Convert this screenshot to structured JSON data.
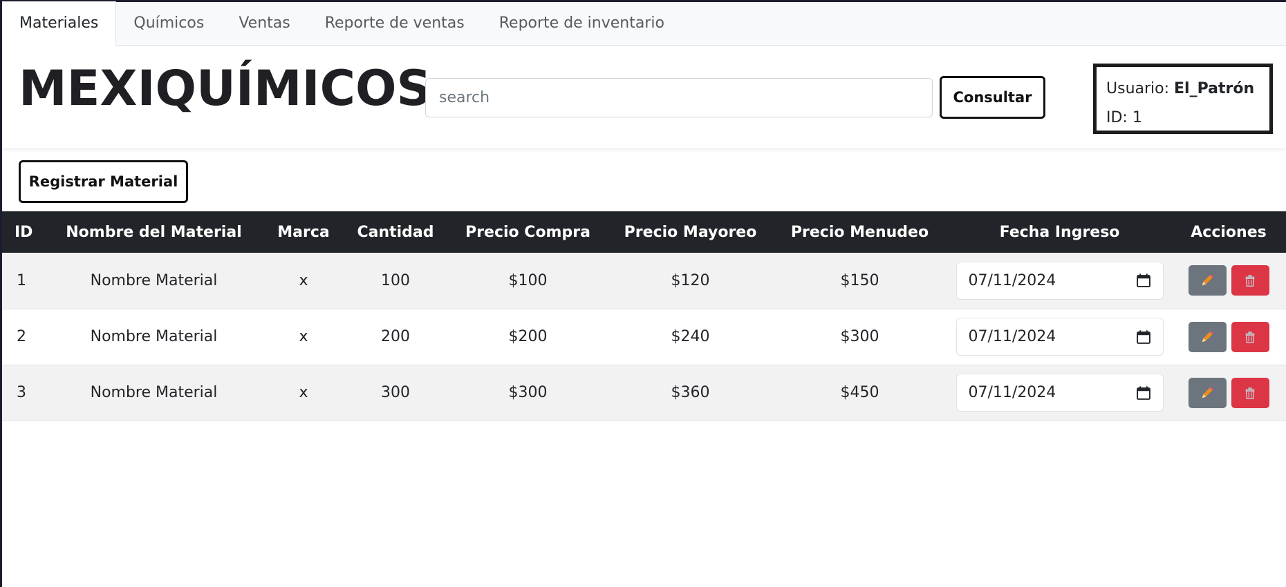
{
  "tabs": [
    {
      "label": "Materiales",
      "active": true
    },
    {
      "label": "Químicos",
      "active": false
    },
    {
      "label": "Ventas",
      "active": false
    },
    {
      "label": "Reporte de ventas",
      "active": false
    },
    {
      "label": "Reporte de inventario",
      "active": false
    }
  ],
  "header": {
    "brand": "MEXIQUÍMICOS",
    "search_placeholder": "search",
    "consultar_label": "Consultar",
    "user_label": "Usuario: ",
    "user_name": "El_Patrón",
    "id_label": "ID: 1"
  },
  "register_label": "Registrar Material",
  "table": {
    "columns": [
      "ID",
      "Nombre del Material",
      "Marca",
      "Cantidad",
      "Precio Compra",
      "Precio Mayoreo",
      "Precio Menudeo",
      "Fecha Ingreso",
      "Acciones"
    ],
    "rows": [
      {
        "id": "1",
        "nombre": "Nombre Material",
        "marca": "x",
        "cantidad": "100",
        "compra": "$100",
        "mayoreo": "$120",
        "menudeo": "$150",
        "fecha": "07/11/2024"
      },
      {
        "id": "2",
        "nombre": "Nombre Material",
        "marca": "x",
        "cantidad": "200",
        "compra": "$200",
        "mayoreo": "$240",
        "menudeo": "$300",
        "fecha": "07/11/2024"
      },
      {
        "id": "3",
        "nombre": "Nombre Material",
        "marca": "x",
        "cantidad": "300",
        "compra": "$300",
        "mayoreo": "$360",
        "menudeo": "$450",
        "fecha": "07/11/2024"
      }
    ]
  },
  "colors": {
    "table_header": "#212529",
    "edit_button": "#6c757d",
    "delete_button": "#dc3545",
    "pencil": "#f08c1c"
  },
  "icons": {
    "edit": "pencil-icon",
    "delete": "trash-icon",
    "date": "calendar-icon"
  }
}
